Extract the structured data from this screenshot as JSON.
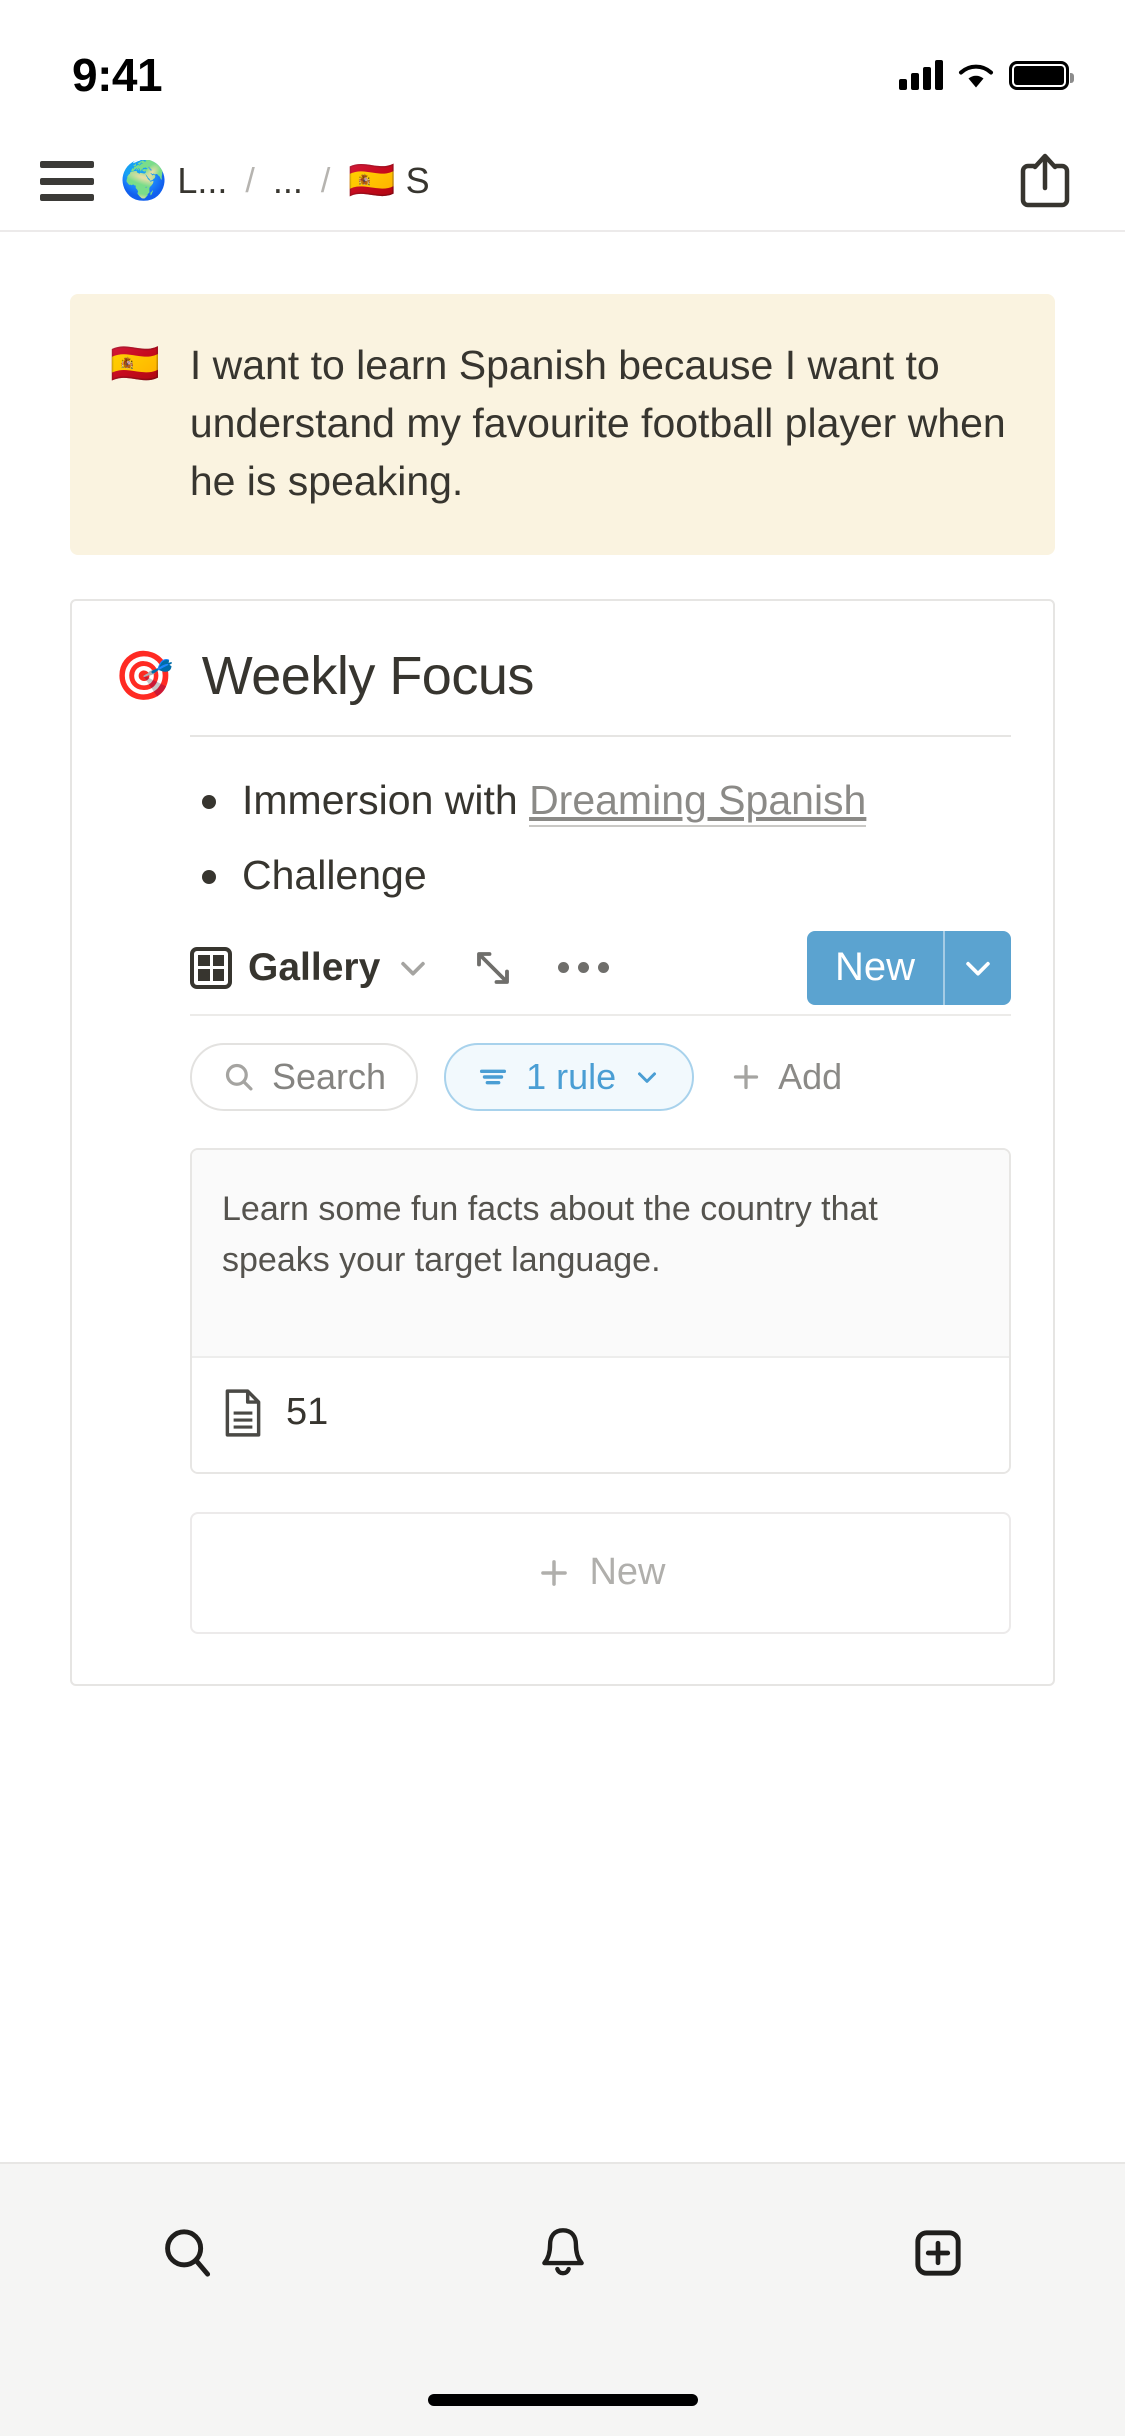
{
  "status_bar": {
    "time": "9:41",
    "signal_icon": "cellular-signal-icon",
    "wifi_icon": "wifi-icon",
    "battery_icon": "battery-full-icon"
  },
  "topbar": {
    "menu_icon": "hamburger-menu-icon",
    "share_icon": "share-icon",
    "breadcrumb": [
      {
        "emoji": "🌍",
        "label": "L..."
      },
      {
        "emoji": "",
        "label": "..."
      },
      {
        "emoji": "🇪🇸",
        "label": "S"
      }
    ],
    "separator": "/"
  },
  "callout": {
    "emoji": "🇪🇸",
    "text": "I want to learn Spanish because I want to understand my favourite football player when he is speaking."
  },
  "focus": {
    "emoji": "🎯",
    "title": "Weekly Focus",
    "bullets": [
      {
        "prefix": "Immersion with ",
        "link": "Dreaming Spanish"
      },
      {
        "prefix": "Challenge",
        "link": ""
      }
    ]
  },
  "database": {
    "view_icon": "gallery-view-icon",
    "view_label": "Gallery",
    "view_chevron_icon": "chevron-down-icon",
    "expand_icon": "expand-diagonal-icon",
    "more_icon": "more-horizontal-icon",
    "new_label": "New",
    "new_caret_icon": "chevron-down-icon",
    "search_placeholder": "Search",
    "search_icon": "search-icon",
    "filter_icon": "filter-lines-icon",
    "filter_label": "1 rule",
    "filter_caret_icon": "chevron-down-icon",
    "add_icon": "plus-icon",
    "add_label": "Add",
    "cards": [
      {
        "description": "Learn some fun facts about the country that speaks your target language.",
        "page_icon": "document-icon",
        "title": "51"
      }
    ],
    "new_row_icon": "plus-icon",
    "new_row_label": "New"
  },
  "bottombar": {
    "tabs": [
      {
        "icon": "search-icon",
        "name": "search"
      },
      {
        "icon": "bell-icon",
        "name": "notifications"
      },
      {
        "icon": "new-page-icon",
        "name": "new-page"
      }
    ]
  },
  "colors": {
    "accent_blue": "#5ba3d0",
    "filter_blue": "#4a9ed4",
    "callout_bg": "#faf3e0",
    "bottombar_bg": "#f5f5f4"
  }
}
